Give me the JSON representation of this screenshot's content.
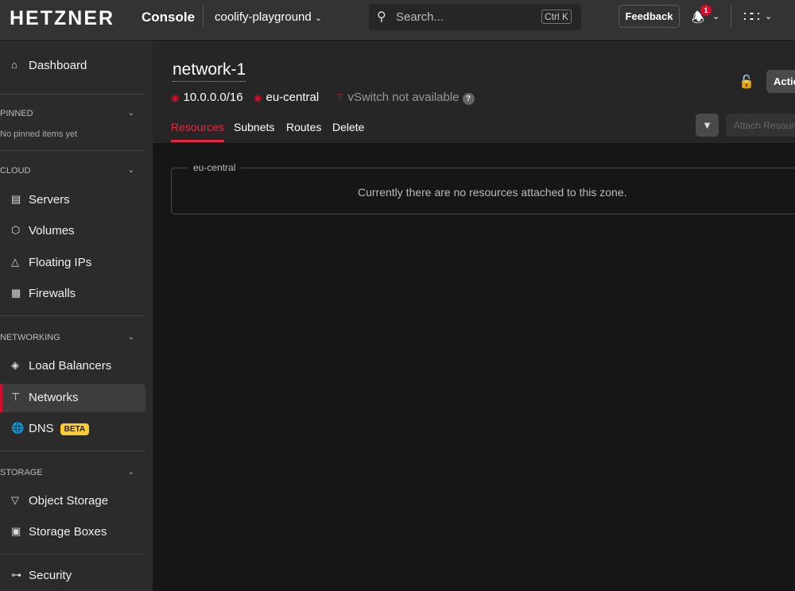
{
  "header": {
    "logo": "HETZNER",
    "app": "Console",
    "project": "coolify-playground",
    "search_placeholder": "Search...",
    "search_shortcut": "Ctrl K",
    "feedback": "Feedback",
    "notification_count": "1"
  },
  "sidebar": {
    "dashboard": "Dashboard",
    "pinned": {
      "label": "PINNED",
      "empty": "No pinned items yet"
    },
    "cloud": {
      "label": "CLOUD",
      "items": [
        "Servers",
        "Volumes",
        "Floating IPs",
        "Firewalls"
      ]
    },
    "networking": {
      "label": "NETWORKING",
      "items": [
        "Load Balancers",
        "Networks",
        "DNS"
      ],
      "dns_badge": "BETA"
    },
    "storage": {
      "label": "STORAGE",
      "items": [
        "Object Storage",
        "Storage Boxes"
      ]
    },
    "security": "Security"
  },
  "network": {
    "name": "network-1",
    "ip_range": "10.0.0.0/16",
    "zone": "eu-central",
    "vswitch": "vSwitch not available",
    "help": "?"
  },
  "tabs": [
    "Resources",
    "Subnets",
    "Routes",
    "Delete"
  ],
  "actions": {
    "actions": "Actions",
    "attach": "Attach Resource"
  },
  "zone_panel": {
    "legend": "eu-central",
    "message": "Currently there are no resources attached to this zone."
  },
  "colors": {
    "accent": "#d50c2d",
    "beta": "#ffcb2e"
  }
}
